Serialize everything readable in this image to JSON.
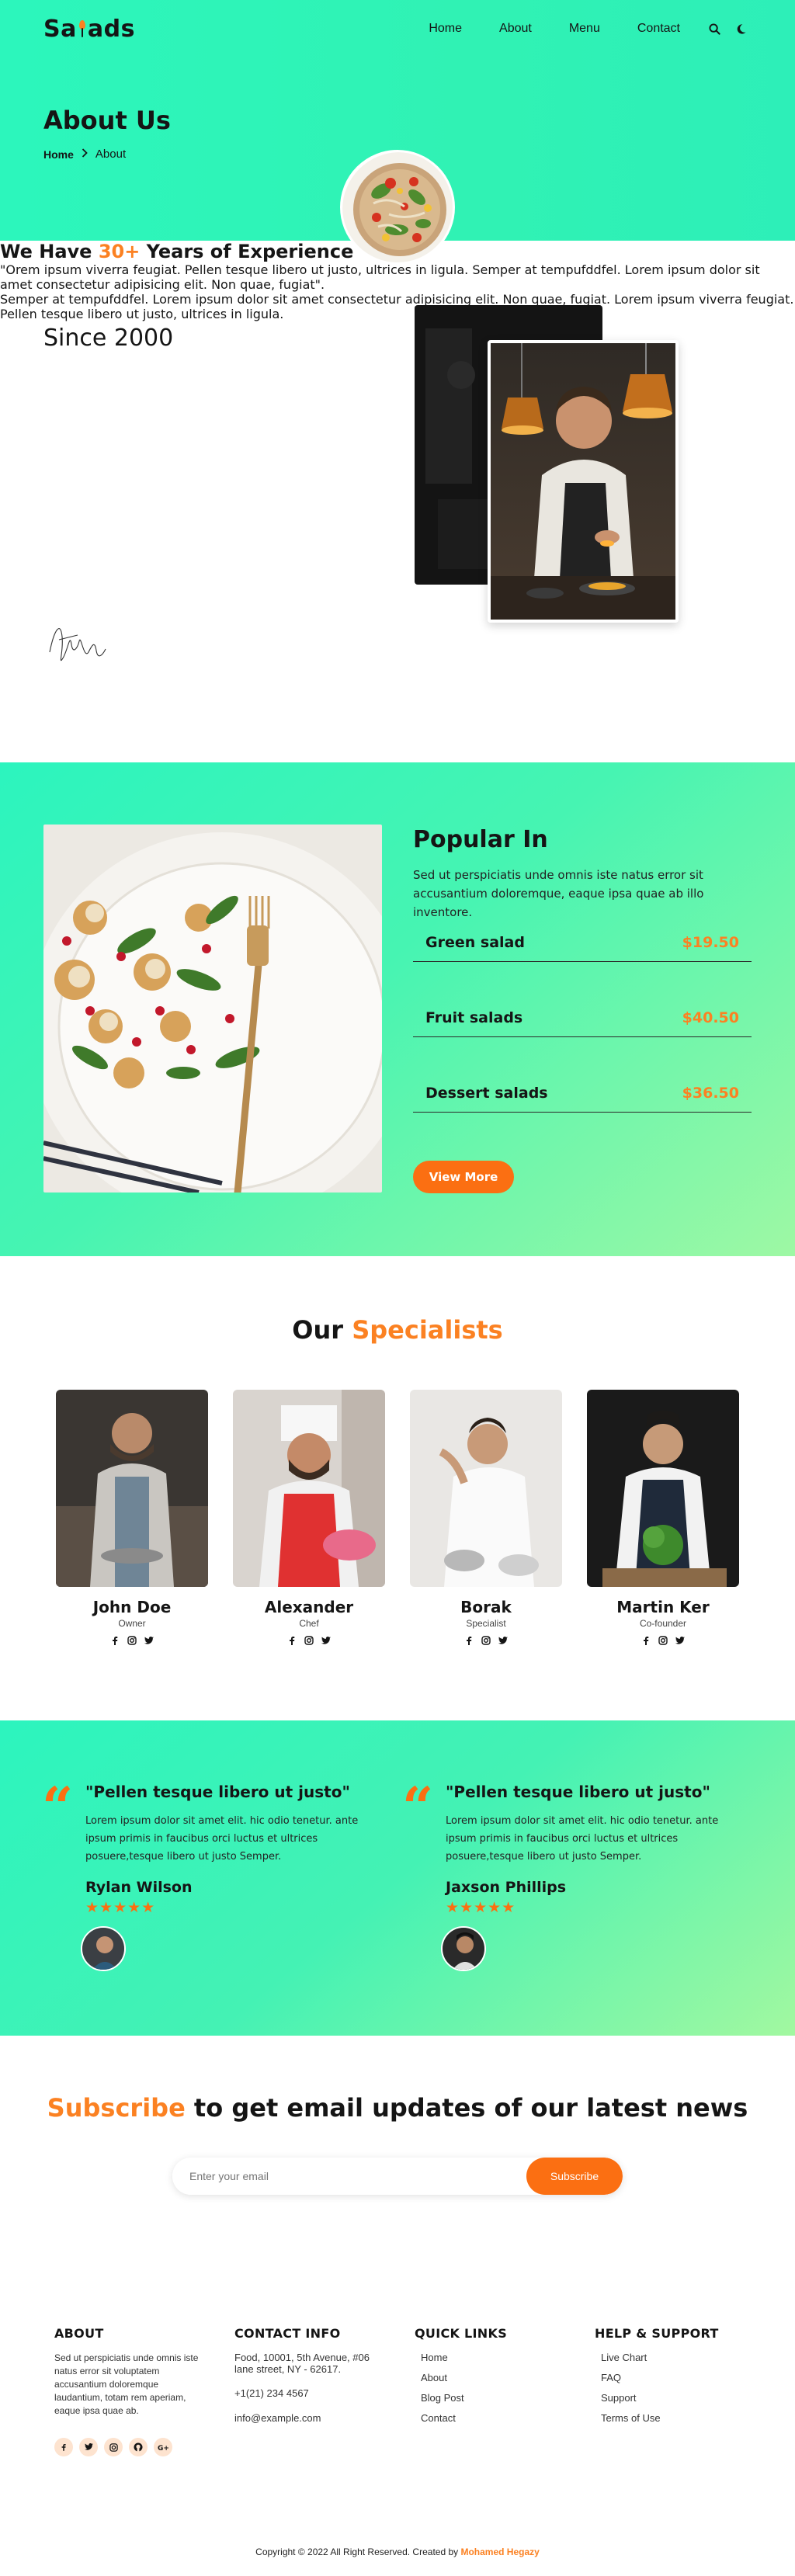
{
  "brand": {
    "logo_left": "Sa",
    "logo_right": "ads",
    "accent": "#fb8122",
    "hero_bg": "#2cf6bc"
  },
  "nav": {
    "items": [
      "Home",
      "About",
      "Menu",
      "Contact"
    ],
    "search_icon": "search-icon",
    "theme_icon": "moon-icon"
  },
  "hero": {
    "title": "About Us",
    "breadcrumb_home": "Home",
    "breadcrumb_current": "About"
  },
  "about": {
    "since": "Since 2000",
    "heading_pre": "We Have ",
    "heading_accent": "30+",
    "heading_post": " Years of Experience",
    "quote": "\"Orem ipsum viverra feugiat. Pellen tesque libero ut justo, ultrices in ligula. Semper at tempufddfel. Lorem ipsum dolor sit amet consectetur adipisicing elit. Non quae, fugiat\".",
    "paragraph": "Semper at tempufddfel. Lorem ipsum dolor sit amet consectetur adipisicing elit. Non quae, fugiat. Lorem ipsum viverra feugiat. Pellen tesque libero ut justo, ultrices in ligula."
  },
  "popular": {
    "title": "Popular In",
    "description": "Sed ut perspiciatis unde omnis iste natus error sit accusantium doloremque, eaque ipsa quae ab illo inventore.",
    "items": [
      {
        "name": "Green salad",
        "price": "$19.50"
      },
      {
        "name": "Fruit salads",
        "price": "$40.50"
      },
      {
        "name": "Dessert salads",
        "price": "$36.50"
      }
    ],
    "button": "View More"
  },
  "specialists": {
    "title_pre": "Our ",
    "title_accent": "Specialists",
    "people": [
      {
        "name": "John Doe",
        "role": "Owner"
      },
      {
        "name": "Alexander",
        "role": "Chef"
      },
      {
        "name": "Borak",
        "role": "Specialist"
      },
      {
        "name": "Martin Ker",
        "role": "Co-founder"
      }
    ]
  },
  "testimonials": [
    {
      "quote": "\"Pellen tesque libero ut justo\"",
      "body": "Lorem ipsum dolor sit amet elit. hic odio tenetur. ante ipsum primis in faucibus orci luctus et ultrices posuere,tesque libero ut justo Semper.",
      "name": "Rylan Wilson",
      "stars": "★★★★★"
    },
    {
      "quote": "\"Pellen tesque libero ut justo\"",
      "body": "Lorem ipsum dolor sit amet elit. hic odio tenetur. ante ipsum primis in faucibus orci luctus et ultrices posuere,tesque libero ut justo Semper.",
      "name": "Jaxson Phillips",
      "stars": "★★★★★"
    }
  ],
  "subscribe": {
    "title_accent": "Subscribe",
    "title_rest": " to get email updates of our latest news",
    "placeholder": "Enter your email",
    "button": "Subscribe"
  },
  "footer": {
    "about_title": "ABOUT",
    "about_text": "Sed ut perspiciatis unde omnis iste natus error sit voluptatem accusantium doloremque laudantium, totam rem aperiam, eaque ipsa quae ab.",
    "contact_title": "CONTACT INFO",
    "address": "Food, 10001, 5th Avenue, #06 lane street, NY - 62617.",
    "phone": "+1(21) 234 4567",
    "email": "info@example.com",
    "quick_title": "QUICK LINKS",
    "quick_links": [
      "Home",
      "About",
      "Blog Post",
      "Contact"
    ],
    "help_title": "HELP & SUPPORT",
    "help_links": [
      "Live Chart",
      "FAQ",
      "Support",
      "Terms of Use"
    ],
    "social_icons": [
      "facebook-icon",
      "twitter-icon",
      "instagram-icon",
      "github-icon",
      "google-plus-icon"
    ],
    "social_glyphs": [
      "f",
      "",
      "",
      "",
      "G+"
    ]
  },
  "copyright": {
    "text": "Copyright © 2022 All Right Reserved. Created by ",
    "author": "Mohamed Hegazy"
  }
}
